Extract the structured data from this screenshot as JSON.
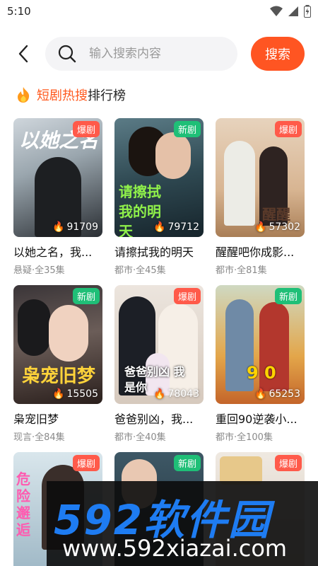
{
  "status_bar": {
    "time": "5:10",
    "icons": [
      "wifi-icon",
      "signal-icon",
      "battery-icon"
    ]
  },
  "header": {
    "back_icon": "chevron-left-icon",
    "search_icon": "search-icon",
    "search_placeholder": "输入搜索内容",
    "search_button": "搜索"
  },
  "rank": {
    "title_highlight": "短剧热搜",
    "title_rest": "排行榜",
    "icon": "flame-icon"
  },
  "colors": {
    "accent": "#ff5522",
    "hot_badge": "#ff5a4a",
    "new_badge": "#1fbf77"
  },
  "dramas": [
    {
      "title": "以她之名，我...",
      "meta": "悬疑·全35集",
      "badge": "爆剧",
      "badge_type": "hot",
      "views": "91709",
      "overlay": "以她之名"
    },
    {
      "title": "请擦拭我的明天",
      "meta": "都市·全45集",
      "badge": "新剧",
      "badge_type": "new",
      "views": "79712",
      "overlay": "请擦拭 我的明天"
    },
    {
      "title": "醒醒吧你成影...",
      "meta": "都市·全81集",
      "badge": "爆剧",
      "badge_type": "hot",
      "views": "57302",
      "overlay": "醒醒"
    },
    {
      "title": "枭宠旧梦",
      "meta": "现言·全84集",
      "badge": "新剧",
      "badge_type": "new",
      "views": "15505",
      "overlay": "枭宠旧梦"
    },
    {
      "title": "爸爸别凶，我...",
      "meta": "都市·全40集",
      "badge": "爆剧",
      "badge_type": "hot",
      "views": "78043",
      "overlay": "爸爸别凶 我是你"
    },
    {
      "title": "重回90逆袭小...",
      "meta": "都市·全100集",
      "badge": "新剧",
      "badge_type": "new",
      "views": "65253",
      "overlay": "9 0"
    },
    {
      "title": "",
      "meta": "",
      "badge": "爆剧",
      "badge_type": "hot",
      "views": "",
      "overlay": "危险邂逅"
    },
    {
      "title": "",
      "meta": "",
      "badge": "新剧",
      "badge_type": "new",
      "views": "",
      "overlay": ""
    },
    {
      "title": "",
      "meta": "",
      "badge": "爆剧",
      "badge_type": "hot",
      "views": "",
      "overlay": ""
    }
  ],
  "watermark": {
    "top": "592软件园",
    "bottom": "www.592xiazai.com"
  }
}
